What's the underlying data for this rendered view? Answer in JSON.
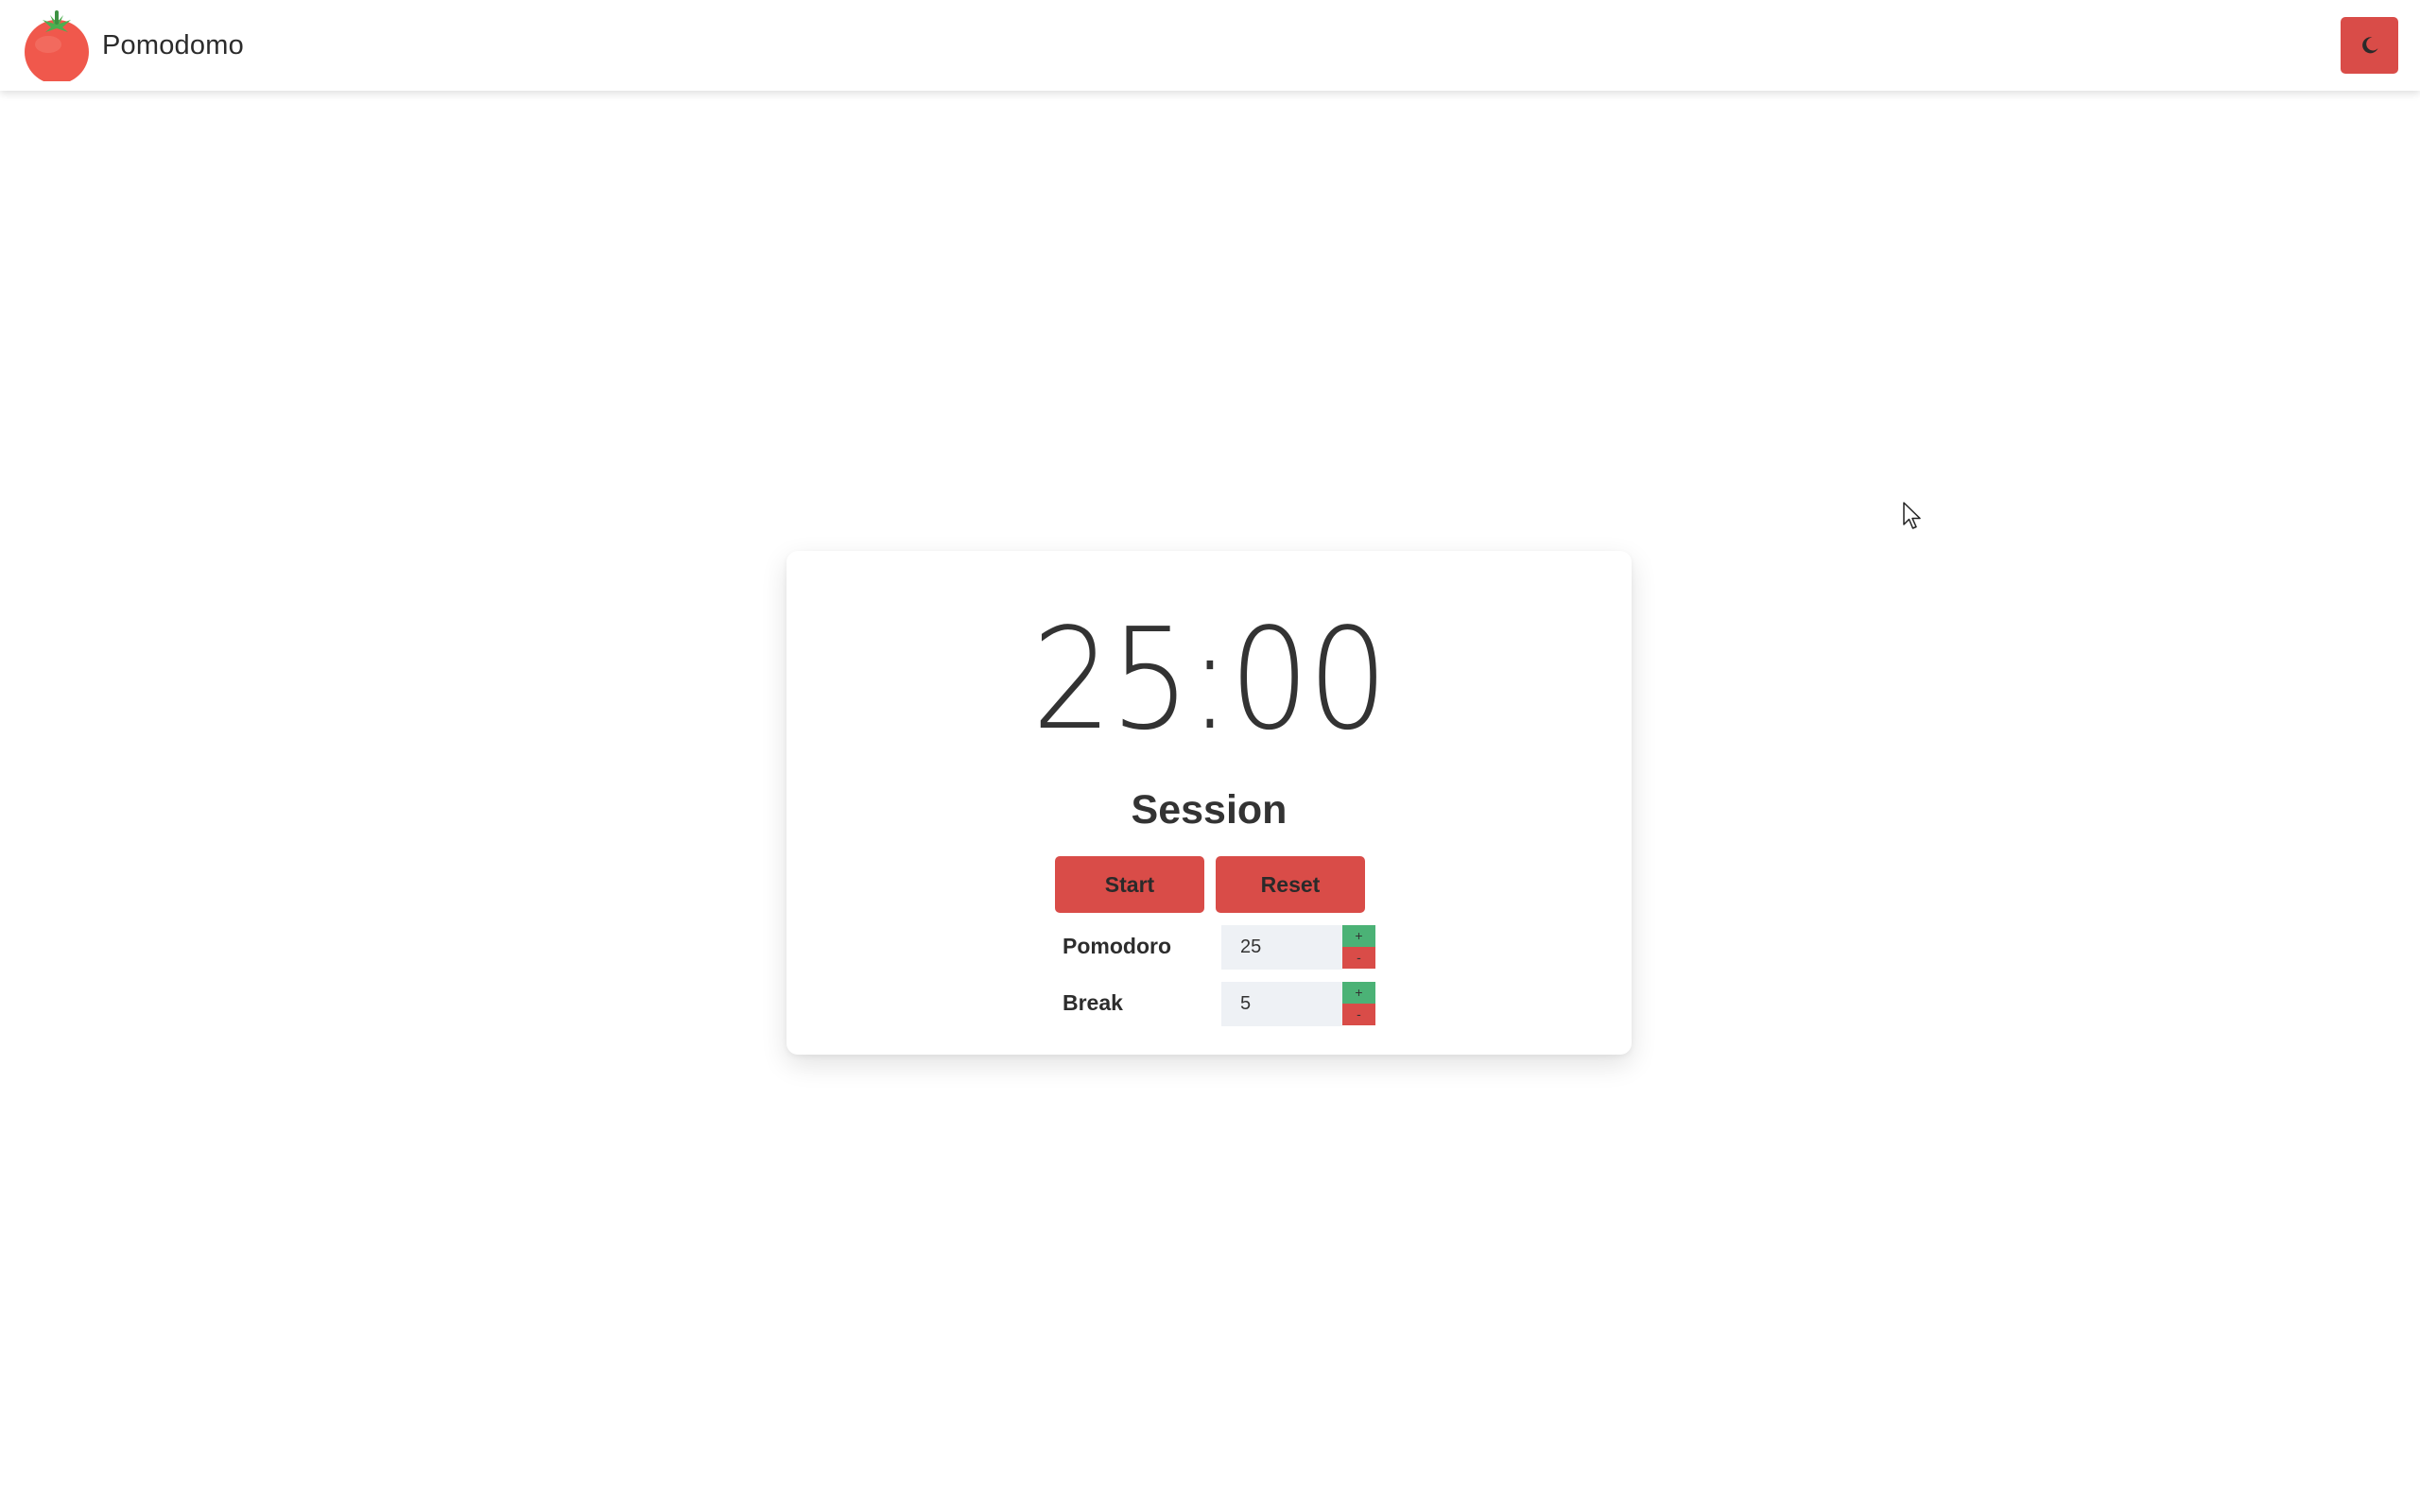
{
  "app": {
    "name": "Pomodomo"
  },
  "header": {
    "theme_toggle_icon": "moon-icon"
  },
  "timer": {
    "display": "25:00",
    "label": "Session",
    "start_label": "Start",
    "reset_label": "Reset"
  },
  "settings": {
    "pomodoro": {
      "label": "Pomodoro",
      "value": "25",
      "plus": "+",
      "minus": "-"
    },
    "break": {
      "label": "Break",
      "value": "5",
      "plus": "+",
      "minus": "-"
    }
  },
  "colors": {
    "accent": "#d94c48",
    "increment": "#4bb276",
    "input_bg": "#eef1f5"
  }
}
